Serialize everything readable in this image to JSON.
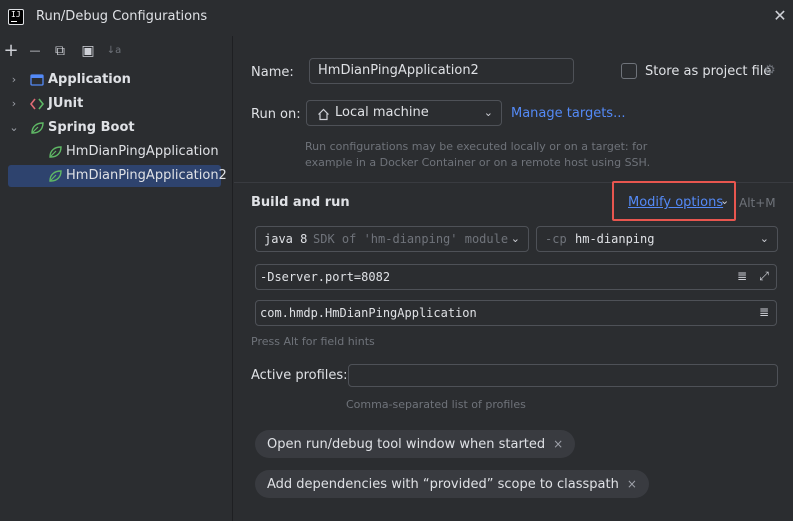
{
  "window": {
    "logo_text": "IJ",
    "title": "Run/Debug Configurations",
    "close_glyph": "✕"
  },
  "toolbar": {
    "add_glyph": "+",
    "remove_glyph": "—",
    "copy_glyph": "⧉",
    "folder_glyph": "▣",
    "sort_glyph": "↓a"
  },
  "tree": {
    "items": [
      {
        "label": "Application",
        "icon": "application-icon"
      },
      {
        "label": "JUnit",
        "icon": "junit-icon"
      },
      {
        "label": "Spring Boot",
        "icon": "spring-boot-icon"
      },
      {
        "label": "HmDianPingApplication",
        "icon": "spring-boot-icon"
      },
      {
        "label": "HmDianPingApplication2",
        "icon": "spring-boot-icon"
      }
    ],
    "chevron_collapsed": "›",
    "chevron_expanded": "⌄"
  },
  "form": {
    "name_label": "Name:",
    "name_value": "HmDianPingApplication2",
    "store_label": "Store as project file",
    "run_on_label": "Run on:",
    "run_on_value": "Local machine",
    "manage_targets": "Manage targets...",
    "run_on_hint_1": "Run configurations may be executed locally or on a target: for",
    "run_on_hint_2": "example in a Docker Container or on a remote host using SSH.",
    "build_run_title": "Build and run",
    "modify_options": "Modify options",
    "modify_shortcut": "Alt+M",
    "jdk_value": "java 8",
    "jdk_detail": "SDK of 'hm-dianping' module",
    "cp_prefix": "-cp",
    "cp_value": "hm-dianping",
    "vm_options": "-Dserver.port=8082",
    "main_class": "com.hmdp.HmDianPingApplication",
    "field_hint": "Press Alt for field hints",
    "active_profiles_label": "Active profiles:",
    "active_profiles_value": "",
    "active_profiles_hint": "Comma-separated list of profiles",
    "chips": [
      {
        "label": "Open run/debug tool window when started"
      },
      {
        "label": "Add dependencies with “provided” scope to classpath"
      }
    ],
    "chip_close": "×",
    "dropdown_arrow": "⌄",
    "gear_glyph": "⚙",
    "list_glyph": "≣",
    "expand_glyph": "⤢"
  },
  "colors": {
    "accent": "#548af7",
    "selection": "#2e436e",
    "highlight": "#e8564f",
    "background": "#2b2d30"
  }
}
